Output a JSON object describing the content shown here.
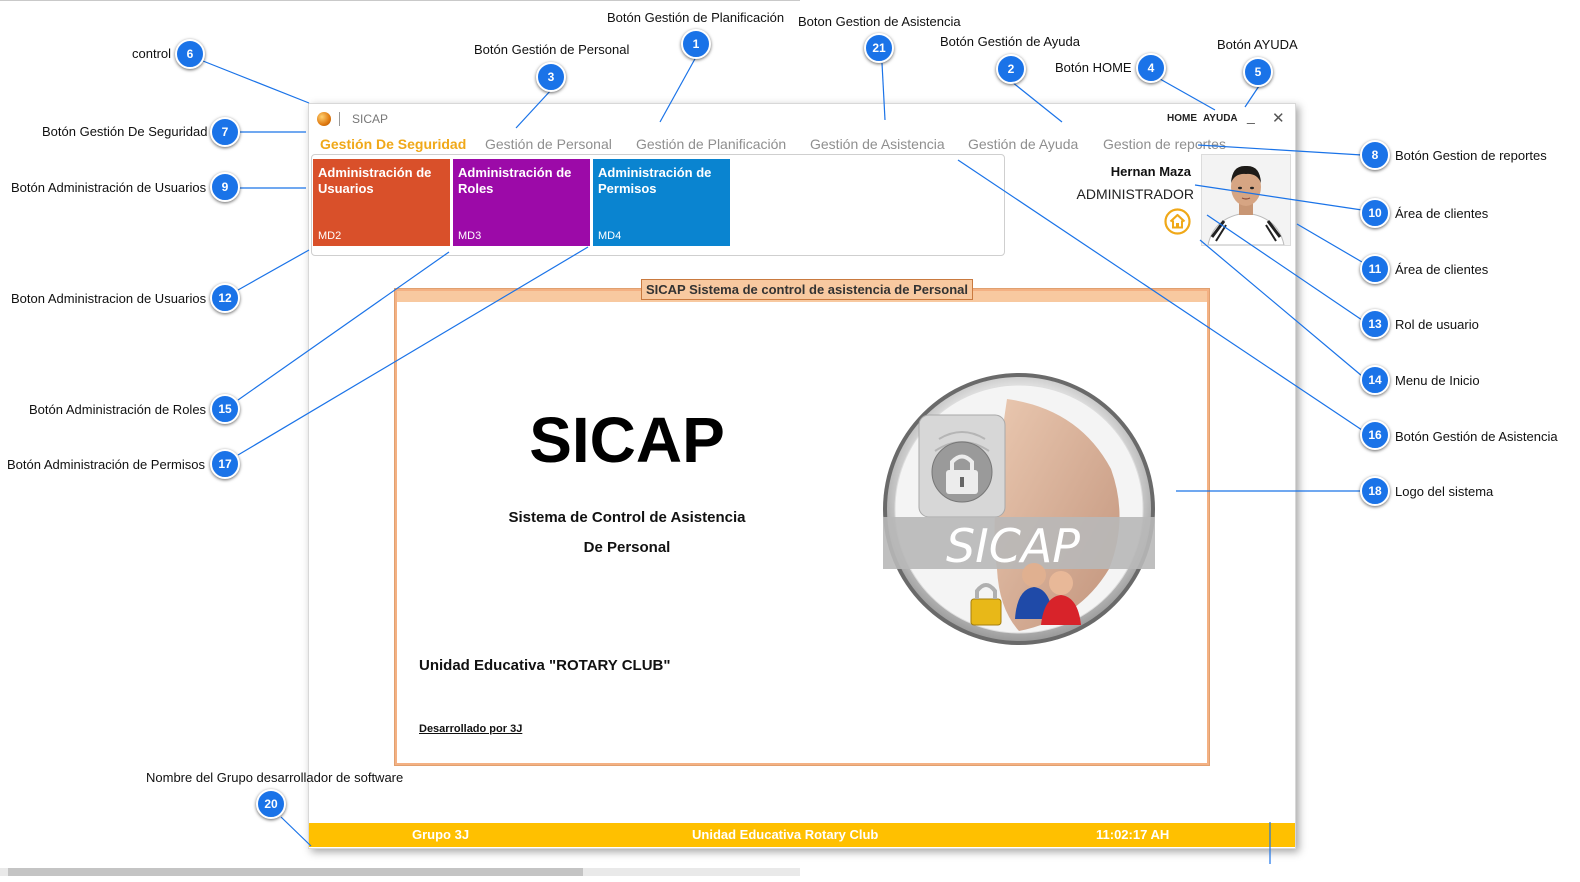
{
  "window": {
    "title": "SICAP",
    "home_label": "HOME",
    "ayuda_label": "AYUDA",
    "minimize_glyph": "_",
    "close_glyph": "✕"
  },
  "tabs": [
    {
      "label": "Gestión De Seguridad",
      "active": true
    },
    {
      "label": "Gestión de Personal",
      "active": false
    },
    {
      "label": "Gestión de Planificación",
      "active": false
    },
    {
      "label": "Gestión de Asistencia",
      "active": false
    },
    {
      "label": "Gestión de Ayuda",
      "active": false
    },
    {
      "label": "Gestion de reportes",
      "active": false
    }
  ],
  "tiles": [
    {
      "label": "Administración de Usuarios",
      "code": "MD2",
      "color": "#d9502a"
    },
    {
      "label": "Administración de Roles",
      "code": "MD3",
      "color": "#9c0aa8"
    },
    {
      "label": "Administración de Permisos",
      "code": "MD4",
      "color": "#0a84d0"
    }
  ],
  "user": {
    "name": "Hernan Maza",
    "role": "ADMINISTRADOR",
    "home_icon": "home-icon",
    "avatar": "user-photo"
  },
  "content": {
    "frame_title": "SICAP Sistema de control de asistencia de Personal",
    "big_title": "SICAP",
    "subtitle_line1": "Sistema de Control de Asistencia",
    "subtitle_line2": "De Personal",
    "school": "Unidad Educativa \"ROTARY CLUB\"",
    "developed_by": "Desarrollado por 3J",
    "logo_text": "SICAP",
    "logo_icons": [
      "fingerprint-lock-icon",
      "thumb-icon",
      "users-lock-icon"
    ]
  },
  "statusbar": {
    "group": "Grupo 3J",
    "school": "Unidad Educativa Rotary Club",
    "time": "11:02:17 AH"
  },
  "annotations": [
    {
      "num": "1",
      "text": "Botón Gestión de Planificación"
    },
    {
      "num": "2",
      "text": "Botón Gestión de Ayuda"
    },
    {
      "num": "3",
      "text": "Botón Gestión de Personal"
    },
    {
      "num": "4",
      "text": "Botón HOME"
    },
    {
      "num": "5",
      "text": "Botón AYUDA"
    },
    {
      "num": "6",
      "text": "control"
    },
    {
      "num": "7",
      "text": "Botón Gestión De Seguridad"
    },
    {
      "num": "8",
      "text": "Botón Gestion de reportes"
    },
    {
      "num": "9",
      "text": "Botón Administración de Usuarios"
    },
    {
      "num": "10",
      "text": "Área de clientes"
    },
    {
      "num": "11",
      "text": "Área de clientes"
    },
    {
      "num": "12",
      "text": "Boton Administracion de Usuarios"
    },
    {
      "num": "13",
      "text": "Rol de usuario"
    },
    {
      "num": "14",
      "text": "Menu de Inicio"
    },
    {
      "num": "15",
      "text": "Botón Administración de Roles"
    },
    {
      "num": "16",
      "text": "Botón Gestión de Asistencia"
    },
    {
      "num": "17",
      "text": "Botón Administración de Permisos"
    },
    {
      "num": "18",
      "text": "Logo del sistema"
    },
    {
      "num": "20",
      "text": "Nombre del Grupo desarrollador de software"
    },
    {
      "num": "21",
      "text": "Boton Gestion de Asistencia"
    }
  ]
}
